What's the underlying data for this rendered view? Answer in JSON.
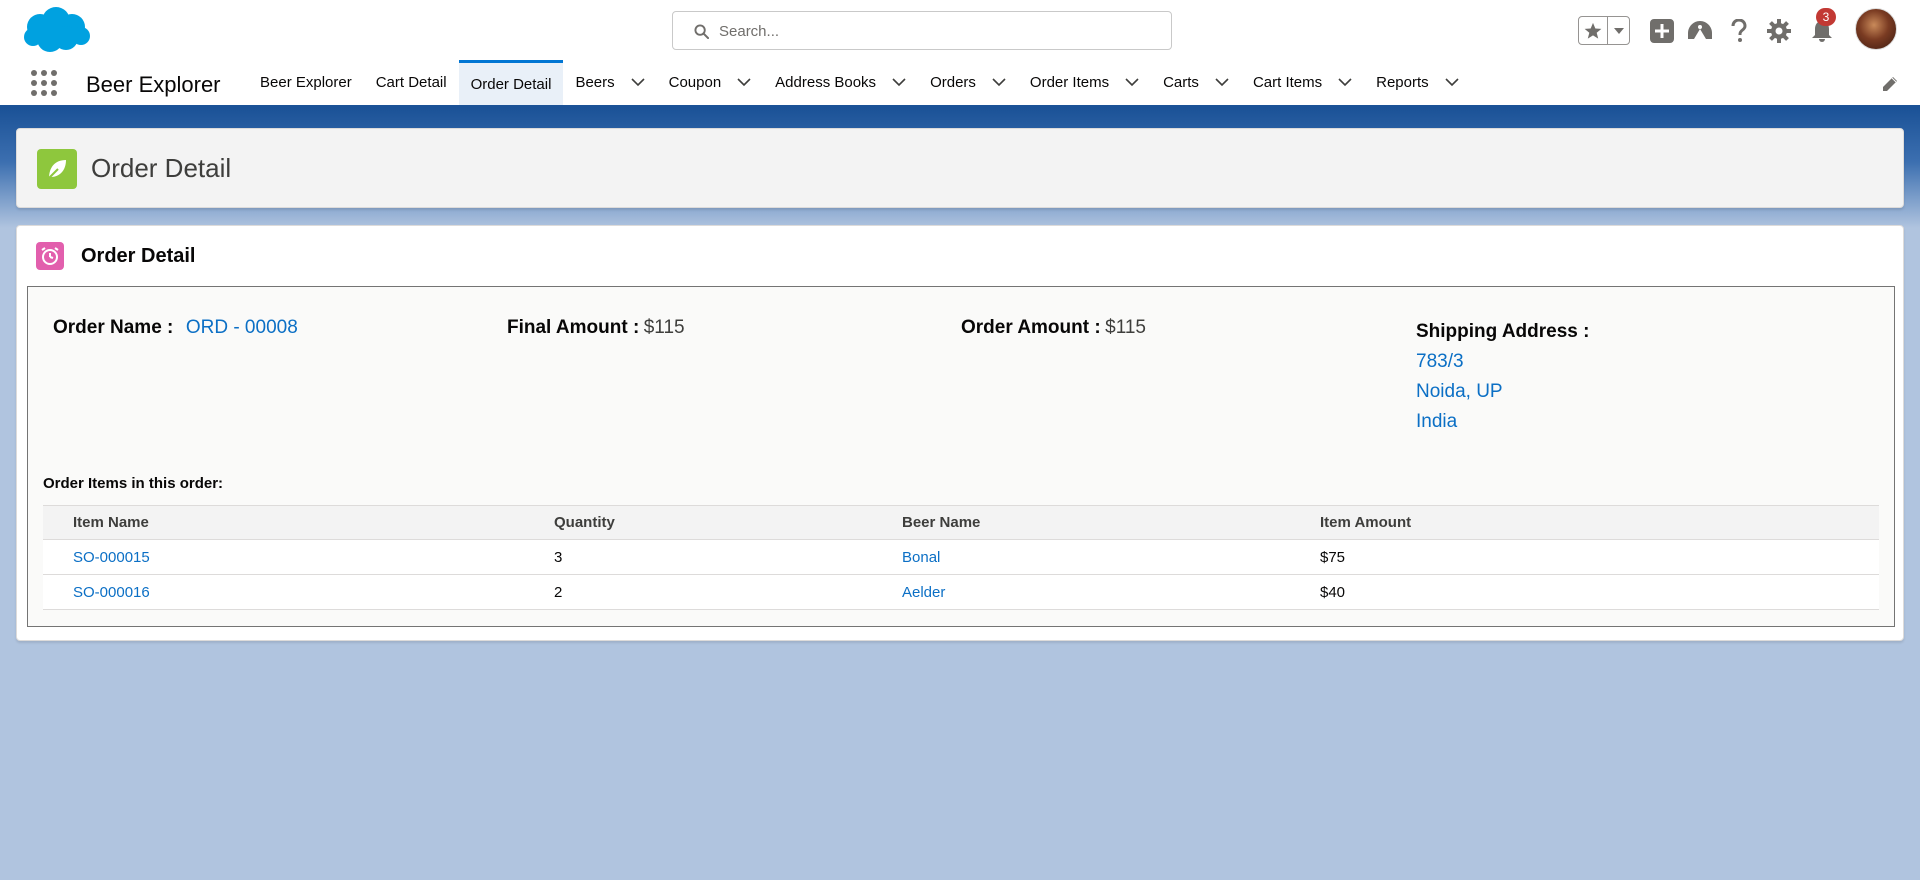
{
  "header": {
    "search_placeholder": "Search...",
    "notification_count": "3"
  },
  "nav": {
    "app_name": "Beer Explorer",
    "tabs": [
      {
        "label": "Beer Explorer",
        "dropdown": false,
        "active": false
      },
      {
        "label": "Cart Detail",
        "dropdown": false,
        "active": false
      },
      {
        "label": "Order Detail",
        "dropdown": false,
        "active": true
      },
      {
        "label": "Beers",
        "dropdown": true,
        "active": false
      },
      {
        "label": "Coupon",
        "dropdown": true,
        "active": false
      },
      {
        "label": "Address Books",
        "dropdown": true,
        "active": false
      },
      {
        "label": "Orders",
        "dropdown": true,
        "active": false
      },
      {
        "label": "Order Items",
        "dropdown": true,
        "active": false
      },
      {
        "label": "Carts",
        "dropdown": true,
        "active": false
      },
      {
        "label": "Cart Items",
        "dropdown": true,
        "active": false
      },
      {
        "label": "Reports",
        "dropdown": true,
        "active": false
      }
    ]
  },
  "page_header": {
    "title": "Order Detail"
  },
  "card": {
    "title": "Order Detail",
    "order_name_label": "Order Name :",
    "order_name_value": "ORD - 00008",
    "final_amount_label": "Final Amount :",
    "final_amount_value": "$115",
    "order_amount_label": "Order Amount :",
    "order_amount_value": "$115",
    "shipping_label": "Shipping Address :",
    "shipping_lines": [
      "783/3",
      "Noida, UP",
      "India"
    ],
    "items_caption": "Order Items in this order:",
    "columns": [
      "Item Name",
      "Quantity",
      "Beer Name",
      "Item Amount"
    ],
    "rows": [
      {
        "item_name": "SO-000015",
        "quantity": "3",
        "beer_name": "Bonal",
        "item_amount": "$75"
      },
      {
        "item_name": "SO-000016",
        "quantity": "2",
        "beer_name": "Aelder",
        "item_amount": "$40"
      }
    ]
  },
  "colors": {
    "brand_blue": "#1b5297",
    "link": "#0b6fc5",
    "page_icon": "#8ec73d",
    "card_icon": "#e25fad",
    "badge": "#c23934"
  },
  "icons": [
    "salesforce-cloud-logo",
    "search-icon",
    "star-icon",
    "caret-down-icon",
    "plus-icon",
    "trailhead-icon",
    "help-icon",
    "gear-icon",
    "bell-icon",
    "app-launcher-icon",
    "chevron-down-icon",
    "pencil-icon",
    "leaf-icon",
    "alarm-clock-icon"
  ]
}
